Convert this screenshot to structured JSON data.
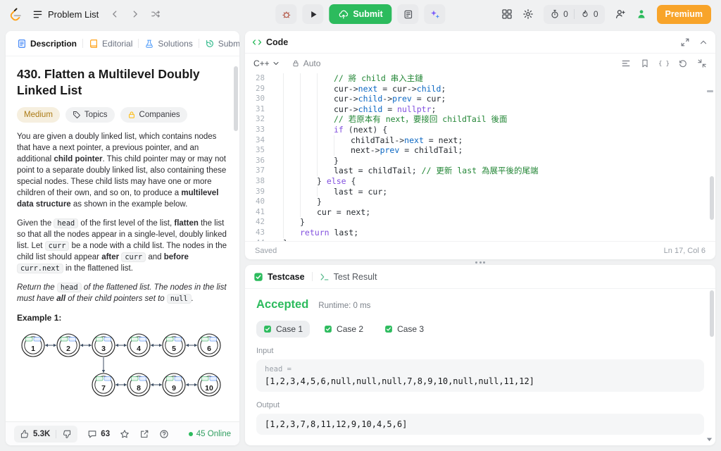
{
  "topbar": {
    "problem_list_label": "Problem List",
    "submit_label": "Submit",
    "premium_label": "Premium",
    "timer_count": "0",
    "streak_count": "0"
  },
  "left": {
    "tabs": [
      {
        "label": "Description",
        "icon": "description-icon",
        "active": true
      },
      {
        "label": "Editorial",
        "icon": "editorial-icon",
        "active": false
      },
      {
        "label": "Solutions",
        "icon": "solutions-icon",
        "active": false
      },
      {
        "label": "Submissions",
        "icon": "submissions-icon",
        "active": false
      }
    ],
    "title": "430. Flatten a Multilevel Doubly Linked List",
    "badges": {
      "difficulty": "Medium",
      "topics": "Topics",
      "companies": "Companies"
    },
    "paragraphs": [
      {
        "style": "normal",
        "parts": [
          [
            "",
            "You are given a doubly linked list, which contains nodes that have a next pointer, a previous pointer, and an additional "
          ],
          [
            "b",
            "child pointer"
          ],
          [
            "",
            ". This child pointer may or may not point to a separate doubly linked list, also containing these special nodes. These child lists may have one or more children of their own, and so on, to produce a "
          ],
          [
            "b",
            "multilevel data structure"
          ],
          [
            "",
            " as shown in the example below."
          ]
        ]
      },
      {
        "style": "normal",
        "parts": [
          [
            "",
            "Given the "
          ],
          [
            "code",
            "head"
          ],
          [
            "",
            " of the first level of the list, "
          ],
          [
            "b",
            "flatten"
          ],
          [
            "",
            " the list so that all the nodes appear in a single-level, doubly linked list. Let "
          ],
          [
            "code",
            "curr"
          ],
          [
            "",
            " be a node with a child list. The nodes in the child list should appear "
          ],
          [
            "b",
            "after"
          ],
          [
            "",
            " "
          ],
          [
            "code",
            "curr"
          ],
          [
            "",
            " and "
          ],
          [
            "b",
            "before"
          ],
          [
            "",
            " "
          ],
          [
            "code",
            "curr.next"
          ],
          [
            "",
            " in the flattened list."
          ]
        ]
      },
      {
        "style": "italic",
        "parts": [
          [
            "",
            "Return the "
          ],
          [
            "code",
            "head"
          ],
          [
            "",
            " of the flattened list. The nodes in the list must have "
          ],
          [
            "b",
            "all"
          ],
          [
            "",
            " of their child pointers set to "
          ],
          [
            "code",
            "null"
          ],
          [
            "",
            "."
          ]
        ]
      }
    ],
    "example_label": "Example 1:",
    "diagram": {
      "row1": [
        1,
        2,
        3,
        4,
        5,
        6
      ],
      "row2": [
        7,
        8,
        9,
        10
      ],
      "child_parent_index": 2
    },
    "footer": {
      "likes": "5.3K",
      "comments": "63",
      "online": "45 Online"
    }
  },
  "code_panel": {
    "title": "Code",
    "language": "C++",
    "auto_label": "Auto",
    "saved_label": "Saved",
    "cursor_label": "Ln 17, Col 6",
    "lines": [
      {
        "n": 28,
        "indent": 3,
        "tokens": [
          [
            "c",
            "// 將 child 串入主鏈"
          ]
        ]
      },
      {
        "n": 29,
        "indent": 3,
        "tokens": [
          [
            "v",
            "cur"
          ],
          [
            "o",
            "->"
          ],
          [
            "p",
            "next"
          ],
          [
            "o",
            " = "
          ],
          [
            "v",
            "cur"
          ],
          [
            "o",
            "->"
          ],
          [
            "p",
            "child"
          ],
          [
            "o",
            ";"
          ]
        ]
      },
      {
        "n": 30,
        "indent": 3,
        "tokens": [
          [
            "v",
            "cur"
          ],
          [
            "o",
            "->"
          ],
          [
            "p",
            "child"
          ],
          [
            "o",
            "->"
          ],
          [
            "p",
            "prev"
          ],
          [
            "o",
            " = "
          ],
          [
            "v",
            "cur"
          ],
          [
            "o",
            ";"
          ]
        ]
      },
      {
        "n": 31,
        "indent": 3,
        "tokens": [
          [
            "v",
            "cur"
          ],
          [
            "o",
            "->"
          ],
          [
            "p",
            "child"
          ],
          [
            "o",
            " = "
          ],
          [
            "k",
            "nullptr"
          ],
          [
            "o",
            ";"
          ]
        ]
      },
      {
        "n": 32,
        "indent": 3,
        "tokens": [
          [
            "c",
            "// 若原本有 next，要接回 childTail 後面"
          ]
        ]
      },
      {
        "n": 33,
        "indent": 3,
        "tokens": [
          [
            "k",
            "if"
          ],
          [
            "o",
            " ("
          ],
          [
            "v",
            "next"
          ],
          [
            "o",
            ") {"
          ]
        ]
      },
      {
        "n": 34,
        "indent": 4,
        "tokens": [
          [
            "v",
            "childTail"
          ],
          [
            "o",
            "->"
          ],
          [
            "p",
            "next"
          ],
          [
            "o",
            " = "
          ],
          [
            "v",
            "next"
          ],
          [
            "o",
            ";"
          ]
        ]
      },
      {
        "n": 35,
        "indent": 4,
        "tokens": [
          [
            "v",
            "next"
          ],
          [
            "o",
            "->"
          ],
          [
            "p",
            "prev"
          ],
          [
            "o",
            " = "
          ],
          [
            "v",
            "childTail"
          ],
          [
            "o",
            ";"
          ]
        ]
      },
      {
        "n": 36,
        "indent": 3,
        "tokens": [
          [
            "o",
            "}"
          ]
        ]
      },
      {
        "n": 37,
        "indent": 3,
        "tokens": [
          [
            "v",
            "last"
          ],
          [
            "o",
            " = "
          ],
          [
            "v",
            "childTail"
          ],
          [
            "o",
            "; "
          ],
          [
            "c",
            "// 更新 last 為展平後的尾端"
          ]
        ]
      },
      {
        "n": 38,
        "indent": 2,
        "tokens": [
          [
            "o",
            "} "
          ],
          [
            "k",
            "else"
          ],
          [
            "o",
            " {"
          ]
        ]
      },
      {
        "n": 39,
        "indent": 3,
        "tokens": [
          [
            "v",
            "last"
          ],
          [
            "o",
            " = "
          ],
          [
            "v",
            "cur"
          ],
          [
            "o",
            ";"
          ]
        ]
      },
      {
        "n": 40,
        "indent": 2,
        "tokens": [
          [
            "o",
            "}"
          ]
        ]
      },
      {
        "n": 41,
        "indent": 2,
        "tokens": [
          [
            "v",
            "cur"
          ],
          [
            "o",
            " = "
          ],
          [
            "v",
            "next"
          ],
          [
            "o",
            ";"
          ]
        ]
      },
      {
        "n": 42,
        "indent": 1,
        "tokens": [
          [
            "o",
            "}"
          ]
        ]
      },
      {
        "n": 43,
        "indent": 1,
        "tokens": [
          [
            "k",
            "return"
          ],
          [
            "t",
            " "
          ],
          [
            "v",
            "last"
          ],
          [
            "o",
            ";"
          ]
        ]
      },
      {
        "n": 44,
        "indent": 0,
        "tokens": [
          [
            "o",
            "}"
          ]
        ]
      }
    ]
  },
  "test_panel": {
    "testcase_tab": "Testcase",
    "result_tab": "Test Result",
    "status": "Accepted",
    "runtime": "Runtime: 0 ms",
    "cases": [
      {
        "label": "Case 1",
        "active": true
      },
      {
        "label": "Case 2",
        "active": false
      },
      {
        "label": "Case 3",
        "active": false
      }
    ],
    "input_label": "Input",
    "input_field": "head =",
    "input_value": "[1,2,3,4,5,6,null,null,null,7,8,9,10,null,null,11,12]",
    "output_label": "Output",
    "output_value": "[1,2,3,7,8,11,12,9,10,4,5,6]"
  }
}
